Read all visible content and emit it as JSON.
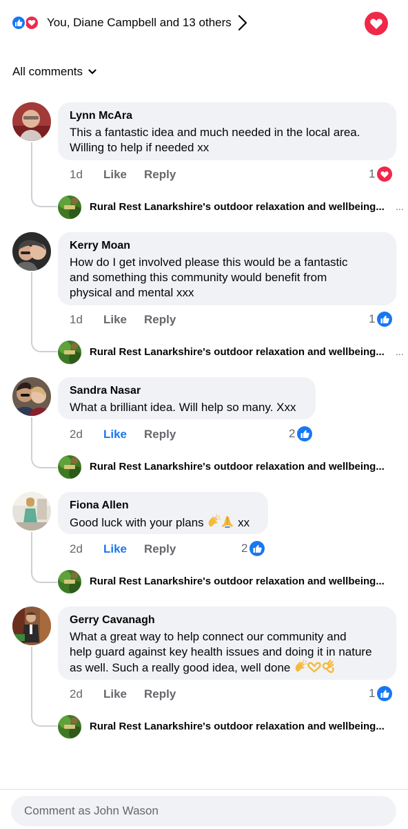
{
  "reactions_summary": {
    "text": "You, Diane Campbell and 13 others"
  },
  "sort": {
    "label": "All comments"
  },
  "colors": {
    "like_blue": "#1877f2",
    "love_red": "#f02849",
    "bubble_bg": "#f0f2f5",
    "meta_gray": "#65676b"
  },
  "comments": [
    {
      "author": "Lynn McAra",
      "lines": [
        "This a fantastic idea and much needed in the local area.",
        "Willing to help if needed xx"
      ],
      "time": "1d",
      "like_label": "Like",
      "reply_label": "Reply",
      "reaction_count": "1",
      "reaction_type": "love",
      "liked": false,
      "reply_preview": "Rural Rest Lanarkshire's outdoor relaxation and wellbeing...",
      "reply_more": "..."
    },
    {
      "author": "Kerry Moan",
      "lines": [
        "How do I get involved please this would be a fantastic",
        "and something this community would benefit from",
        "physical and mental xxx"
      ],
      "time": "1d",
      "like_label": "Like",
      "reply_label": "Reply",
      "reaction_count": "1",
      "reaction_type": "like",
      "liked": false,
      "reply_preview": "Rural Rest Lanarkshire's outdoor relaxation and wellbeing...",
      "reply_more": "..."
    },
    {
      "author": "Sandra Nasar",
      "lines": [
        "What a brilliant idea. Will help so many. Xxx"
      ],
      "time": "2d",
      "like_label": "Like",
      "reply_label": "Reply",
      "reaction_count": "2",
      "reaction_type": "like",
      "liked": true,
      "reply_preview": "Rural Rest Lanarkshire's outdoor relaxation and wellbeing...",
      "reply_more": ""
    },
    {
      "author": "Fiona Allen",
      "lines": [
        "Good luck with your plans"
      ],
      "line_end": "xx",
      "emojis": [
        "clapping-hands",
        "folded-hands"
      ],
      "time": "2d",
      "like_label": "Like",
      "reply_label": "Reply",
      "reaction_count": "2",
      "reaction_type": "like",
      "liked": true,
      "reply_preview": "Rural Rest Lanarkshire's outdoor relaxation and wellbeing...",
      "reply_more": ""
    },
    {
      "author": "Gerry Cavanagh",
      "lines": [
        "What a great way to help connect our community and",
        "help guard against key health issues and doing it in nature",
        "as well. Such a really good idea, well done"
      ],
      "emojis": [
        "clapping-hands",
        "heart-hands",
        "ok-hand"
      ],
      "time": "2d",
      "like_label": "Like",
      "reply_label": "Reply",
      "reaction_count": "1",
      "reaction_type": "like",
      "liked": false,
      "reply_preview": "Rural Rest Lanarkshire's outdoor relaxation and wellbeing...",
      "reply_more": ""
    }
  ],
  "composer": {
    "placeholder": "Comment as John Wason"
  }
}
